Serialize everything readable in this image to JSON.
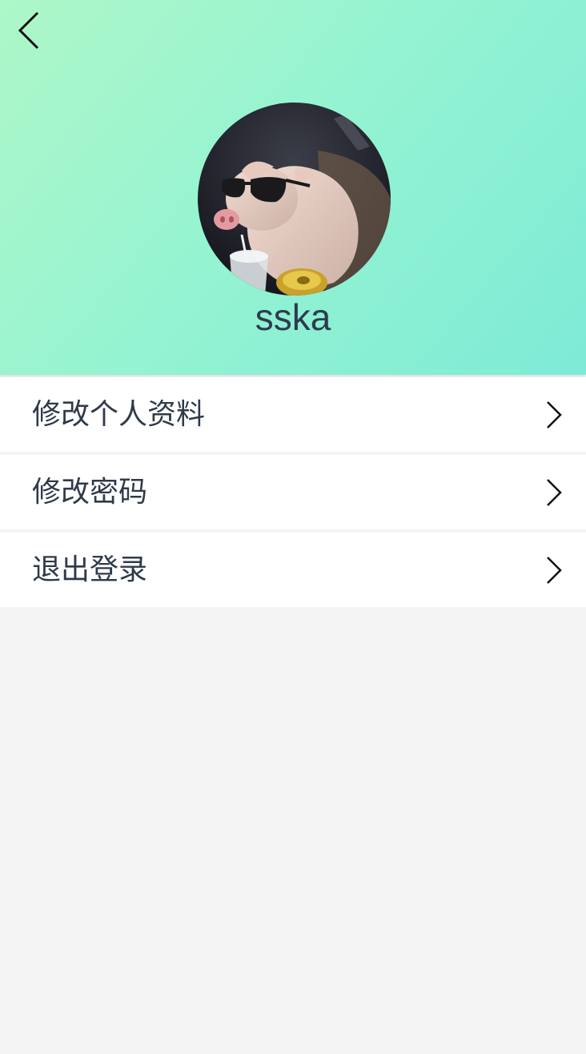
{
  "profile": {
    "username": "sska",
    "avatar_icon": "pig-with-sunglasses-photo"
  },
  "nav": {
    "back_icon": "chevron-left-icon"
  },
  "menu": {
    "items": [
      {
        "label": "修改个人资料"
      },
      {
        "label": "修改密码"
      },
      {
        "label": "退出登录"
      }
    ]
  },
  "colors": {
    "header_gradient_start": "#aef7c8",
    "header_gradient_end": "#7eead6",
    "page_background": "#f4f4f4",
    "text": "#2f3a4a"
  }
}
